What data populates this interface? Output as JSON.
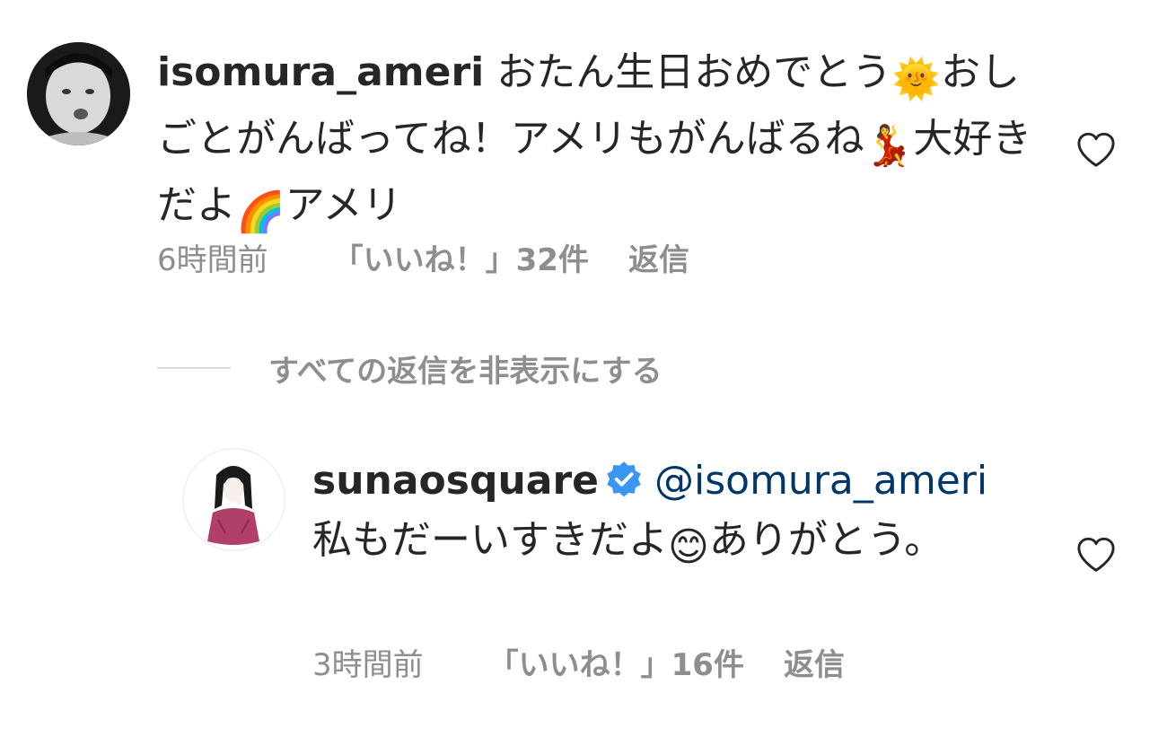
{
  "comment": {
    "username": "isomura_ameri",
    "text_part1": "おたん生日おめでとう",
    "emoji_sun": "🌞",
    "text_part2": "おしごとがんばってね！アメリもがんばるね",
    "emoji_dancer": "💃",
    "text_part3": "大好きだよ",
    "emoji_rainbow": "🌈",
    "text_part4": "アメリ",
    "time": "6時間前",
    "likes": "「いいね！」32件",
    "reply_label": "返信"
  },
  "hide_replies": {
    "label": "すべての返信を非表示にする"
  },
  "reply": {
    "username": "sunaosquare",
    "mention": "@isomura_ameri",
    "text_part1": "私もだーいすきだよ",
    "emoji_smile": "😊",
    "text_part2": "ありがとう。",
    "time": "3時間前",
    "likes": "「いいね！」16件",
    "reply_label": "返信"
  },
  "colors": {
    "text": "#262626",
    "secondary": "#8e8e8e",
    "mention": "#00376b",
    "verified": "#3897f0",
    "divider": "#dbdbdb"
  },
  "icons": {
    "like": "heart-icon",
    "verified": "verified-badge-icon"
  }
}
